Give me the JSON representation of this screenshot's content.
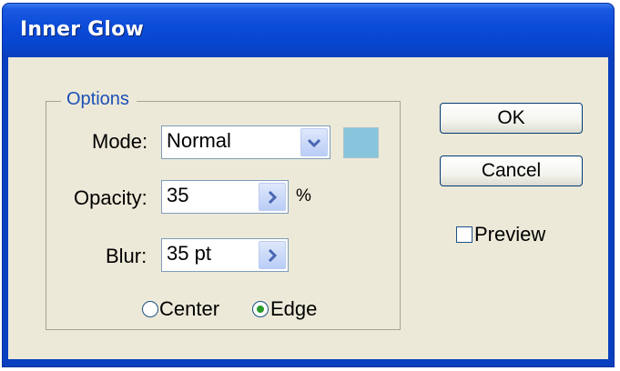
{
  "window": {
    "title": "Inner Glow"
  },
  "options": {
    "group_label": "Options",
    "mode": {
      "label": "Mode:",
      "value": "Normal",
      "dropdown_icon": "chevron-down-icon"
    },
    "glow_color": "#86c5dc",
    "opacity": {
      "label": "Opacity:",
      "value": "35",
      "unit": "%"
    },
    "blur": {
      "label": "Blur:",
      "value": "35 pt"
    },
    "source": {
      "center_label": "Center",
      "edge_label": "Edge",
      "selected": "Edge"
    }
  },
  "buttons": {
    "ok": "OK",
    "cancel": "Cancel"
  },
  "preview": {
    "label": "Preview",
    "checked": false
  }
}
